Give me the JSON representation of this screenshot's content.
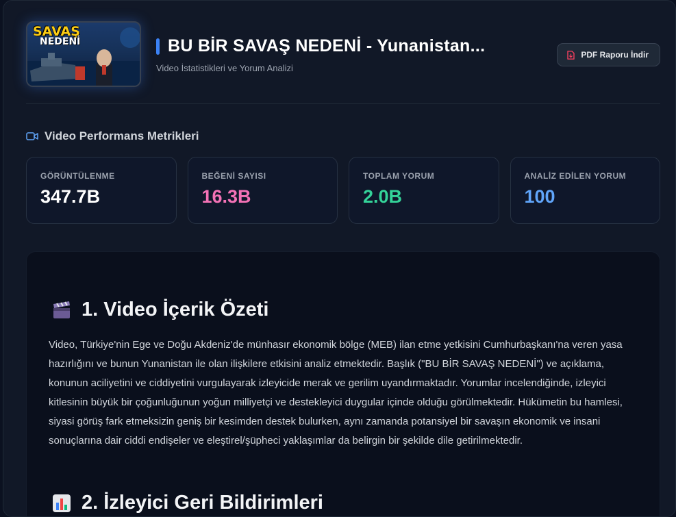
{
  "header": {
    "thumbnail": {
      "line1": "SAVAŞ",
      "line2": "NEDENİ"
    },
    "title": "BU BİR SAVAŞ NEDENİ - Yunanistan...",
    "subtitle": "Video İstatistikleri ve Yorum Analizi",
    "pdf_button_label": "PDF Raporu İndir"
  },
  "metrics_section": {
    "title": "Video Performans Metrikleri",
    "cards": [
      {
        "label": "GÖRÜNTÜLENME",
        "value": "347.7B",
        "color": "#ffffff"
      },
      {
        "label": "BEĞENİ SAYISI",
        "value": "16.3B",
        "color": "#f472b6"
      },
      {
        "label": "TOPLAM YORUM",
        "value": "2.0B",
        "color": "#34d399"
      },
      {
        "label": "ANALİZ EDİLEN YORUM",
        "value": "100",
        "color": "#60a5fa"
      }
    ]
  },
  "analysis": {
    "section1": {
      "icon": "clapper-board-icon",
      "title": "1. Video İçerik Özeti",
      "text": "Video, Türkiye'nin Ege ve Doğu Akdeniz'de münhasır ekonomik bölge (MEB) ilan etme yetkisini Cumhurbaşkanı'na veren yasa hazırlığını ve bunun Yunanistan ile olan ilişkilere etkisini analiz etmektedir. Başlık (\"BU BİR SAVAŞ NEDENİ\") ve açıklama, konunun aciliyetini ve ciddiyetini vurgulayarak izleyicide merak ve gerilim uyandırmaktadır. Yorumlar incelendiğinde, izleyici kitlesinin büyük bir çoğunluğunun yoğun milliyetçi ve destekleyici duygular içinde olduğu görülmektedir. Hükümetin bu hamlesi, siyasi görüş fark etmeksizin geniş bir kesimden destek bulurken, aynı zamanda potansiyel bir savaşın ekonomik ve insani sonuçlarına dair ciddi endişeler ve eleştirel/şüpheci yaklaşımlar da belirgin bir şekilde dile getirilmektedir."
    },
    "section2": {
      "icon": "bar-chart-icon",
      "title": "2. İzleyici Geri Bildirimleri"
    }
  },
  "colors": {
    "accent": "#3b82f6",
    "pdf_icon": "#f43f5e",
    "camera_icon": "#60a5fa"
  }
}
